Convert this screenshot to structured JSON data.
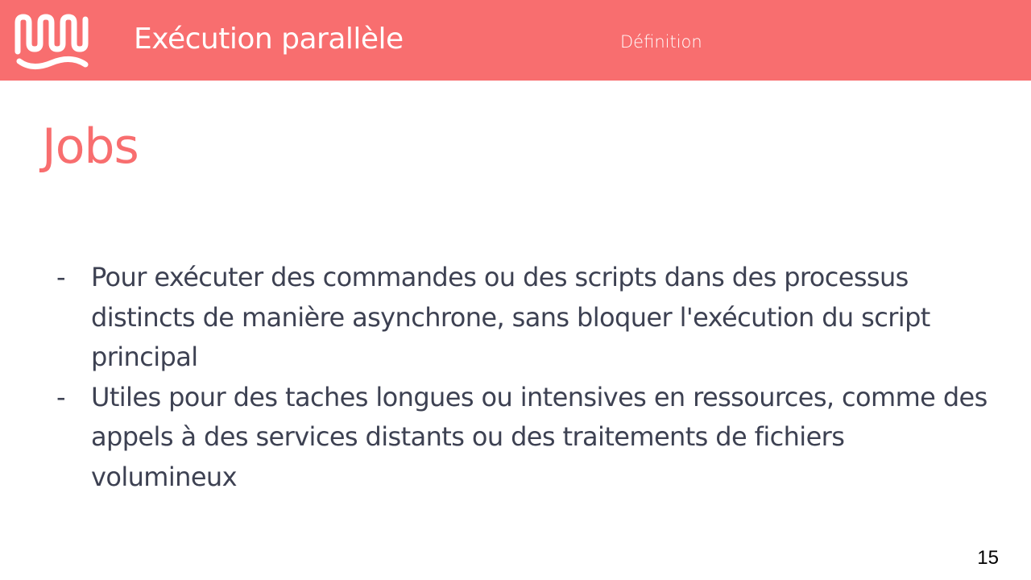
{
  "header": {
    "title": "Exécution parallèle",
    "section": "Définition",
    "logo_icon": "wave-logo-icon",
    "background_color": "#f86e6f"
  },
  "slide": {
    "title": "Jobs",
    "title_color": "#f86e6f",
    "bullet_marker": "-",
    "bullets": [
      "Pour exécuter des commandes ou des scripts dans des processus distincts de manière asynchrone, sans bloquer l'exécution du script principal",
      "Utiles pour des taches longues ou intensives en ressources, comme des appels à des services distants ou des traitements de fichiers volumineux"
    ],
    "text_color": "#3d4152"
  },
  "footer": {
    "page_number": "15"
  }
}
